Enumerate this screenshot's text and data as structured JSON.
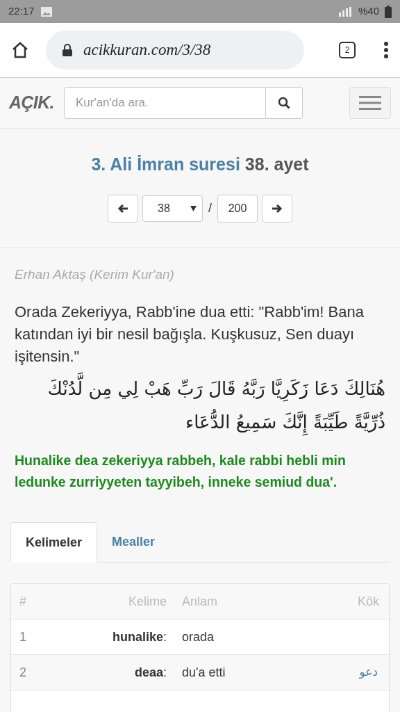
{
  "status_bar": {
    "time": "22:17",
    "battery": "%40"
  },
  "browser": {
    "url": "acikkuran.com/3/38",
    "tab_count": "2"
  },
  "header": {
    "logo": "AÇIK.",
    "search": {
      "placeholder": "Kur'an'da ara."
    }
  },
  "title": {
    "surah": "3. Ali İmran suresi",
    "verse": "38. ayet"
  },
  "pager": {
    "verse": "38",
    "total": "200",
    "separator": "/"
  },
  "translation": {
    "author": "Erhan Aktaş (Kerim Kur'an)",
    "text": "Orada Zekeriyya, Rabb'ine dua etti: \"Rabb'im! Bana katından iyi bir nesil bağışla. Kuşkusuz, Sen duayı işitensin.\"",
    "arabic": "هُنَالِكَ دَعَا زَكَرِيَّا رَبَّهُ قَالَ رَبِّ هَبْ لِي مِن لَّدُنْكَ ذُرِّيَّةً طَيِّبَةً إِنَّكَ سَمِيعُ الدُّعَاء",
    "transcription": "Hunalike dea zekeriyya rabbeh, kale rabbi hebli min ledunke zurriyyeten tayyibeh, inneke semiud dua'."
  },
  "tabs": [
    {
      "label": "Kelimeler",
      "selected": true
    },
    {
      "label": "Mealler",
      "selected": false
    }
  ],
  "table": {
    "columns": [
      "#",
      "Kelime",
      "Anlam",
      "Kök"
    ],
    "rows": [
      {
        "number": "1",
        "word": "**hunalike**:",
        "meaning": "orada"
      },
      {
        "number": "2",
        "word": "**deaa**:",
        "meaning": "du'a etti",
        "root": "دعو"
      }
    ]
  }
}
